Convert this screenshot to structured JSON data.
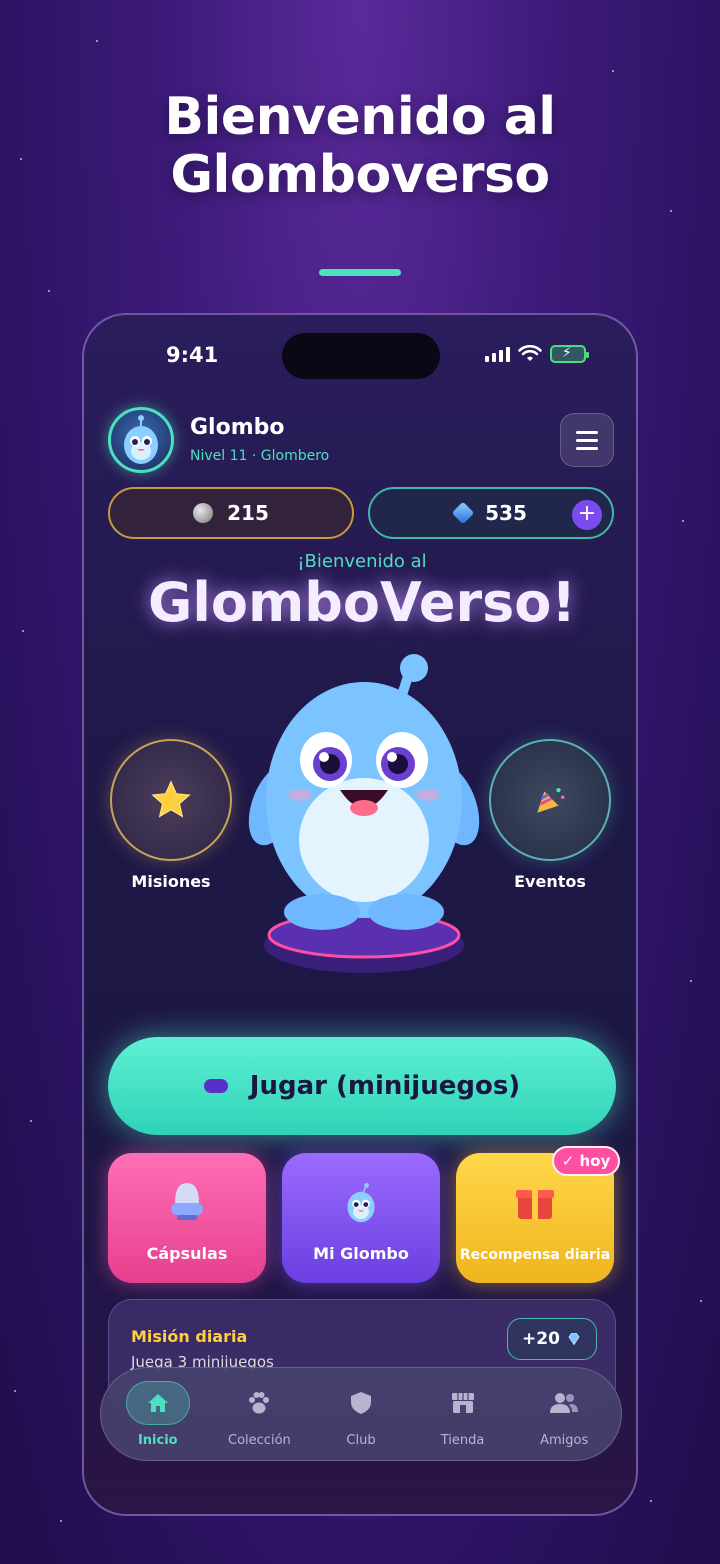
{
  "promo": {
    "title_line1": "Bienvenido al",
    "title_line2": "Glomboverso"
  },
  "status_bar": {
    "time": "9:41"
  },
  "profile": {
    "name": "Glombo",
    "level": "Nivel 11 · Glombero"
  },
  "currency": {
    "moons": "215",
    "gems": "535",
    "add_label": "+"
  },
  "welcome": {
    "small": "¡Bienvenido al",
    "big": "GlomboVerso!"
  },
  "side_buttons": {
    "missions": "Misiones",
    "events": "Eventos"
  },
  "play_button": {
    "label": "Jugar (minijuegos)"
  },
  "tiles": {
    "capsules": "Cápsulas",
    "my_glombo": "Mi Glombo",
    "daily_reward": "Recompensa diaria",
    "badge": "✓ hoy"
  },
  "mission": {
    "title": "Misión diaria",
    "subtitle": "Juega 3 minijuegos",
    "reward": "+20"
  },
  "tabbar": {
    "items": [
      {
        "label": "Inicio",
        "icon": "home-icon",
        "active": true
      },
      {
        "label": "Colección",
        "icon": "paw-icon"
      },
      {
        "label": "Club",
        "icon": "shield-icon"
      },
      {
        "label": "Tienda",
        "icon": "store-icon"
      },
      {
        "label": "Amigos",
        "icon": "friends-icon"
      }
    ]
  },
  "colors": {
    "accent": "#4de0c0",
    "background": "#3b1a78",
    "pink": "#ff6fb5",
    "purple": "#7a4cf0",
    "gold": "#ffd74a"
  }
}
